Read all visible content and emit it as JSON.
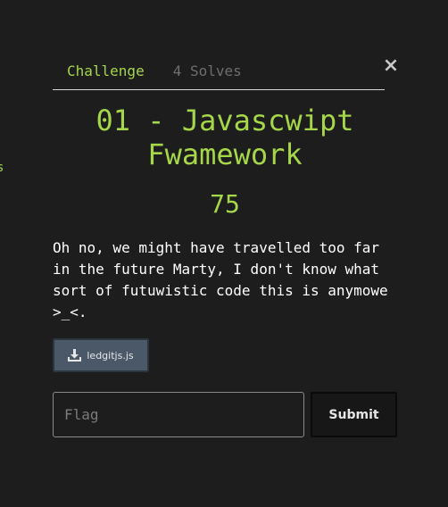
{
  "background_glimpse": "s",
  "tabs": [
    {
      "label": "Challenge",
      "active": true
    },
    {
      "label": "4 Solves",
      "active": false
    }
  ],
  "close": {
    "glyph": "×",
    "icon": "close-icon"
  },
  "challenge": {
    "title": "01 - Javascwipt Fwamework",
    "points": "75",
    "description": "Oh no, we might have travelled too far\nin the future Marty, I don't know what\nsort of futuwistic code this is anymowe\n>_<."
  },
  "file": {
    "label": "ledgitjs.js",
    "icon": "download-icon"
  },
  "flag": {
    "placeholder": "Flag",
    "value": ""
  },
  "submit": {
    "label": "Submit"
  },
  "colors": {
    "accent": "#a6d64a",
    "background": "#1c1d1c",
    "file_button": "#4a5868",
    "muted_tab": "#6e6e6e"
  }
}
